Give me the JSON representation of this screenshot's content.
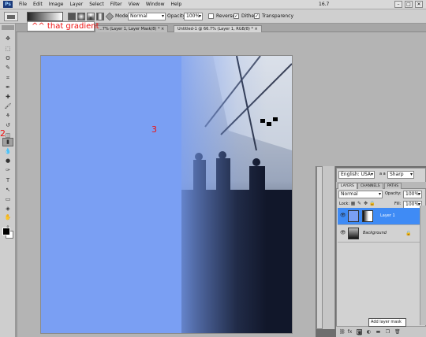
{
  "menu": {
    "logo": "Ps",
    "items": [
      "File",
      "Edit",
      "Image",
      "Layer",
      "Select",
      "Filter",
      "View",
      "Window",
      "Help"
    ],
    "zoom": "16.7",
    "window_buttons": [
      "–",
      "□",
      "✕"
    ]
  },
  "options": {
    "mode_label": "Mode:",
    "mode_value": "Normal",
    "opacity_label": "Opacity:",
    "opacity_value": "100%",
    "reverse_label": "Reverse",
    "dither_label": "Dither",
    "transparency_label": "Transparency"
  },
  "annotation": {
    "tooltip_text": "^^ that gradient",
    "marker_2": "2",
    "marker_3": "3",
    "marker_1": "1"
  },
  "tabs": [
    {
      "label": "...7% (Layer 1, Layer Mask/8) *  ×"
    },
    {
      "label": "Untitled-1 @ 66.7% (Layer 1, RGB/8) *  ×"
    }
  ],
  "toolbox": {
    "tools": [
      "move-icon",
      "marquee-icon",
      "lasso-icon",
      "quick-select-icon",
      "crop-icon",
      "eyedropper-icon",
      "healing-icon",
      "brush-icon",
      "stamp-icon",
      "history-brush-icon",
      "eraser-icon",
      "gradient-icon",
      "blur-icon",
      "dodge-icon",
      "pen-icon",
      "type-icon",
      "path-select-icon",
      "shape-icon",
      "3d-icon",
      "hand-icon",
      "zoom-icon"
    ],
    "tool_glyphs": [
      "✥",
      "⬚",
      "ʘ",
      "✎",
      "⌗",
      "✒",
      "✚",
      "🖌",
      "⚘",
      "↺",
      "◫",
      "▮",
      "💧",
      "●",
      "✑",
      "T",
      "↖",
      "▭",
      "◈",
      "✋",
      "⌕"
    ]
  },
  "panel": {
    "language": "English: USA",
    "aa_mode": "Sharp",
    "aa_label": "a a",
    "tabs": [
      "LAYERS",
      "CHANNELS",
      "PATHS"
    ],
    "blend_mode": "Normal",
    "opacity_label": "Opacity:",
    "opacity_value": "100%",
    "lock_label": "Lock:",
    "fill_label": "Fill:",
    "fill_value": "100%",
    "layers": [
      {
        "name": "Layer 1",
        "selected": true
      },
      {
        "name": "Background",
        "selected": false
      }
    ],
    "tooltip": "Add layer mask",
    "bottom_icons": [
      "link-icon",
      "fx-icon",
      "layer-mask-icon",
      "adjustment-icon",
      "group-icon",
      "new-layer-icon",
      "trash-icon"
    ],
    "bottom_glyphs": [
      "⛓",
      "fx",
      "◙",
      "◐",
      "▬",
      "❐",
      "🗑"
    ]
  }
}
